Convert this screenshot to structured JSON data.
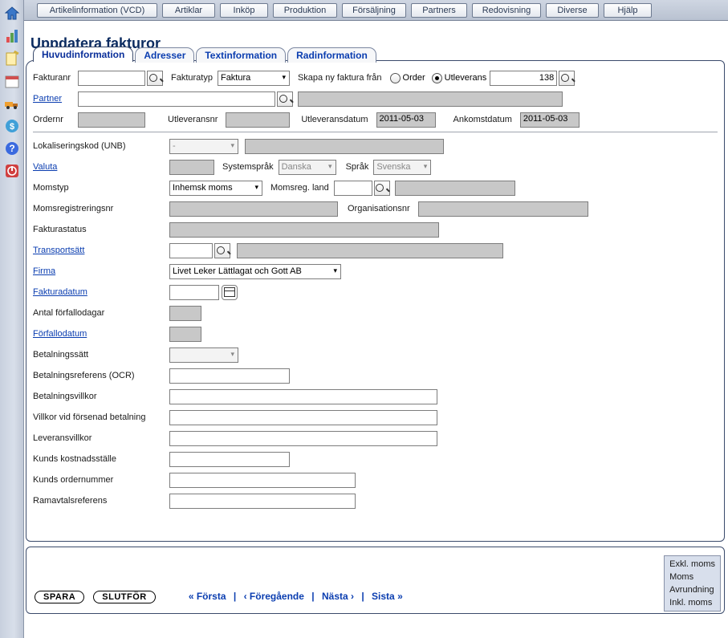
{
  "topnav": [
    "Artikelinformation (VCD)",
    "Artiklar",
    "Inköp",
    "Produktion",
    "Försäljning",
    "Partners",
    "Redovisning",
    "Diverse",
    "Hjälp"
  ],
  "page_title": "Uppdatera fakturor",
  "tabs": [
    "Huvudinformation",
    "Adresser",
    "Textinformation",
    "Radinformation"
  ],
  "row1": {
    "fakturanr_label": "Fakturanr",
    "fakturatyp_label": "Fakturatyp",
    "fakturatyp_value": "Faktura",
    "skapa_label": "Skapa ny faktura från",
    "radio_order": "Order",
    "radio_utleverans": "Utleverans",
    "utleverans_value": "138"
  },
  "row2": {
    "partner_label": "Partner"
  },
  "row3": {
    "ordernr_label": "Ordernr",
    "utleveransnr_label": "Utleveransnr",
    "utleveransdatum_label": "Utleveransdatum",
    "utleveransdatum_value": "2011-05-03",
    "ankomstdatum_label": "Ankomstdatum",
    "ankomstdatum_value": "2011-05-03"
  },
  "form": {
    "lokaliseringskod_label": "Lokaliseringskod (UNB)",
    "lokaliseringskod_value": "-",
    "valuta_label": "Valuta",
    "systemsprak_label": "Systemspråk",
    "systemsprak_value": "Danska",
    "sprak_label": "Språk",
    "sprak_value": "Svenska",
    "momstyp_label": "Momstyp",
    "momstyp_value": "Inhemsk moms",
    "momsreg_land_label": "Momsreg. land",
    "momsreg_nr_label": "Momsregistreringsnr",
    "orgnr_label": "Organisationsnr",
    "fakturastatus_label": "Fakturastatus",
    "transportsatt_label": "Transportsätt",
    "firma_label": "Firma",
    "firma_value": "Livet Leker Lättlagat och Gott AB",
    "fakturadatum_label": "Fakturadatum",
    "antal_forf_label": "Antal förfallodagar",
    "forfallodatum_label": "Förfallodatum",
    "betalningssatt_label": "Betalningssätt",
    "betalningsref_label": "Betalningsreferens (OCR)",
    "betalningsvillkor_label": "Betalningsvillkor",
    "villkor_forsenad_label": "Villkor vid försenad betalning",
    "leveransvillkor_label": "Leveransvillkor",
    "kunds_kostn_label": "Kunds kostnadsställe",
    "kunds_ordernr_label": "Kunds ordernummer",
    "ramavtal_label": "Ramavtalsreferens"
  },
  "actions": {
    "spara": "SPARA",
    "slutfor": "SLUTFÖR"
  },
  "pager": {
    "forsta": "« Första",
    "foregaende": "‹ Föregående",
    "nasta": "Nästa ›",
    "sista": "Sista »"
  },
  "moms": {
    "exkl": "Exkl. moms",
    "moms": "Moms",
    "avrundning": "Avrundning",
    "inkl": "Inkl. moms"
  }
}
